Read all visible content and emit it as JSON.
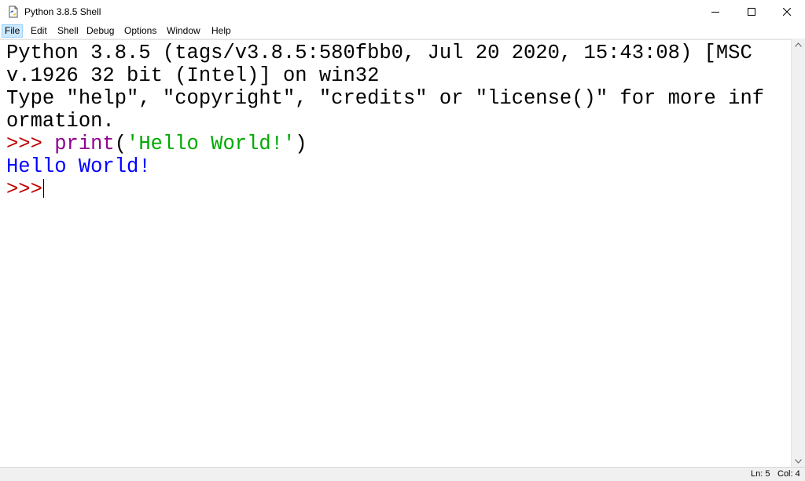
{
  "window": {
    "title": "Python 3.8.5 Shell",
    "icon": "python-idle-icon",
    "controls": [
      "minimize-icon",
      "maximize-icon",
      "close-icon"
    ]
  },
  "menu": {
    "items": [
      {
        "label": "File",
        "active": true
      },
      {
        "label": "Edit"
      },
      {
        "label": "Shell"
      },
      {
        "label": "Debug"
      },
      {
        "label": "Options"
      },
      {
        "label": "Window"
      },
      {
        "label": "Help"
      }
    ]
  },
  "shell": {
    "line1": "Python 3.8.5 (tags/v3.8.5:580fbb0, Jul 20 2020, 15:43:08) [MSC",
    "line2": "v.1926 32 bit (Intel)] on win32",
    "line3": "Type \"help\", \"copyright\", \"credits\" or \"license()\" for more inf",
    "line4": "ormation.",
    "prompt": ">>> ",
    "command": {
      "builtin": "print",
      "open_paren": "(",
      "string": "'Hello World!'",
      "close_paren": ")"
    },
    "output": "Hello World!",
    "prompt2": ">>>"
  },
  "colors": {
    "prompt": "#c00000",
    "builtin": "#900090",
    "string": "#00aa00",
    "output": "#0000ff"
  },
  "status": {
    "ln": "Ln: 5",
    "col": "Col: 4"
  }
}
